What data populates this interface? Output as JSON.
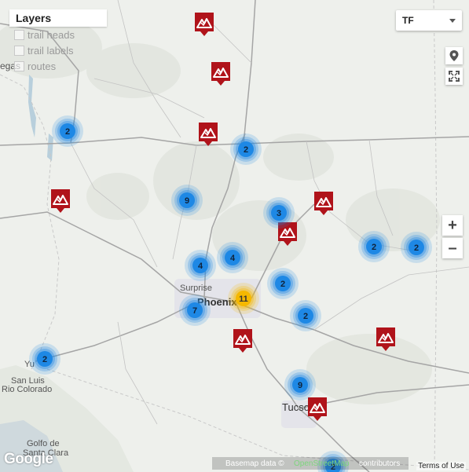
{
  "layers_panel": {
    "title": "Layers",
    "items": [
      {
        "label": "trail heads"
      },
      {
        "label": "trail labels"
      },
      {
        "label": "routes"
      }
    ]
  },
  "filter_select": {
    "value": "TF"
  },
  "controls": {
    "zoom_in": "+",
    "zoom_out": "–",
    "location_icon": "location-pin-icon",
    "fullscreen_icon": "fullscreen-icon"
  },
  "map_labels": {
    "vegas": "egas",
    "surprise": "Surprise",
    "phoenix": "Phoenix",
    "yuma": "Yu",
    "san_luis": "San Luis",
    "rio_colorado": "Rio Colorado",
    "tucson": "Tucso",
    "golfo": "Golfo de",
    "santa_clara": "Santa Clara"
  },
  "clusters": [
    {
      "count": "2",
      "color": "#1e88e5"
    },
    {
      "count": "2",
      "color": "#1e88e5"
    },
    {
      "count": "9",
      "color": "#1e88e5"
    },
    {
      "count": "3",
      "color": "#1e88e5"
    },
    {
      "count": "2",
      "color": "#1e88e5"
    },
    {
      "count": "2",
      "color": "#1e88e5"
    },
    {
      "count": "4",
      "color": "#1e88e5"
    },
    {
      "count": "4",
      "color": "#1e88e5"
    },
    {
      "count": "2",
      "color": "#1e88e5"
    },
    {
      "count": "11",
      "color": "#f5b800"
    },
    {
      "count": "7",
      "color": "#1e88e5"
    },
    {
      "count": "2",
      "color": "#1e88e5"
    },
    {
      "count": "2",
      "color": "#1e88e5"
    },
    {
      "count": "9",
      "color": "#1e88e5"
    },
    {
      "count": "2",
      "color": "#1e88e5"
    }
  ],
  "trail_markers_icon": "mountain-marker-icon",
  "attribution": {
    "basemap": "Basemap data ©",
    "osm": "OpenStreetMap",
    "contributors": "contributors",
    "google": "Google",
    "terms": "Terms of Use"
  },
  "colors": {
    "marker_red": "#b0131a",
    "cluster_blue": "#1e88e5",
    "cluster_yellow": "#f5b800",
    "osm_green": "#7dd67d"
  }
}
